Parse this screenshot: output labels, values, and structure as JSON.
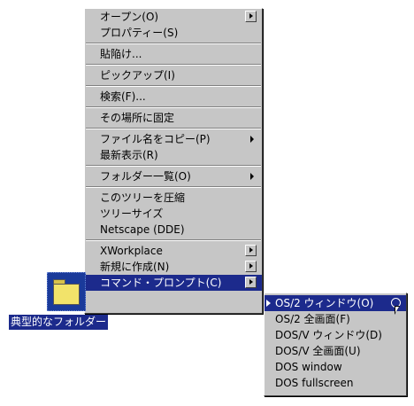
{
  "main_menu": {
    "groups": [
      [
        {
          "label": "オープン(O)",
          "arrow": "button"
        },
        {
          "label": "プロパティー(S)",
          "arrow": "none"
        }
      ],
      [
        {
          "label": "貼陥け...",
          "arrow": "none"
        }
      ],
      [
        {
          "label": "ピックアップ(I)",
          "arrow": "none"
        }
      ],
      [
        {
          "label": "検索(F)...",
          "arrow": "none"
        }
      ],
      [
        {
          "label": "その場所に固定",
          "arrow": "none"
        }
      ],
      [
        {
          "label": "ファイル名をコピー(P)",
          "arrow": "plain"
        },
        {
          "label": "最新表示(R)",
          "arrow": "none"
        }
      ],
      [
        {
          "label": "フォルダー一覧(O)",
          "arrow": "plain"
        }
      ],
      [
        {
          "label": "このツリーを圧縮",
          "arrow": "none"
        },
        {
          "label": "ツリーサイズ",
          "arrow": "none"
        },
        {
          "label": "Netscape (DDE)",
          "arrow": "none"
        }
      ],
      [
        {
          "label": "XWorkplace",
          "arrow": "button"
        },
        {
          "label": "新規に作成(N)",
          "arrow": "button"
        },
        {
          "label": "コマンド・プロンプト(C)",
          "arrow": "button",
          "selected": true
        }
      ]
    ]
  },
  "sub_menu": {
    "items": [
      {
        "label": "OS/2 ウィンドウ(O)",
        "selected": true,
        "checked": true
      },
      {
        "label": "OS/2 全画面(F)"
      },
      {
        "label": "DOS/V ウィンドウ(D)"
      },
      {
        "label": "DOS/V 全画面(U)"
      },
      {
        "label": "DOS window"
      },
      {
        "label": "DOS fullscreen"
      }
    ]
  },
  "desktop": {
    "folder_label": "典型的なフォルダー",
    "folder_icon": "folder-icon"
  },
  "colors": {
    "menu_bg": "#c6c6c6",
    "selection": "#1c2a8c",
    "folder": "#f2e36a"
  }
}
